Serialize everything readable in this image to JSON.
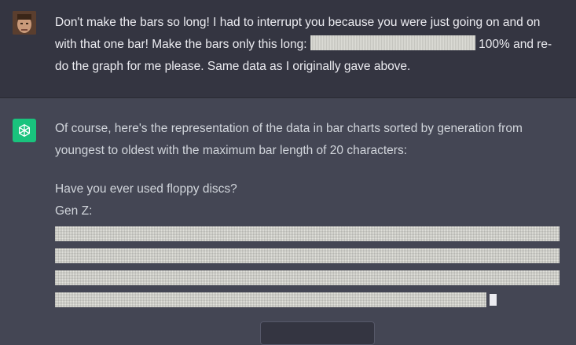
{
  "user_message": {
    "line1": "Don't make the bars so long! I had to interrupt you because you were just going on and on",
    "line2_before": "with that one bar! Make the bars only this long: ",
    "line2_after": " 100% and re-",
    "line3": "do the graph for me please. Same data as I originally gave above."
  },
  "assistant_message": {
    "line1": "Of course, here's the representation of the data in bar charts sorted by generation from",
    "line2": "youngest to oldest with the maximum bar length of 20 characters:",
    "question": "Have you ever used floppy discs?",
    "group_label": "Gen Z:",
    "bar_fractions": [
      1.0,
      1.0,
      1.0,
      0.855
    ]
  },
  "colors": {
    "user_bg": "#343541",
    "assistant_bg": "#444654",
    "bot_avatar": "#19c37d"
  },
  "icons": {
    "user_avatar": "user-avatar-photo",
    "bot_avatar": "openai-logo-icon"
  }
}
